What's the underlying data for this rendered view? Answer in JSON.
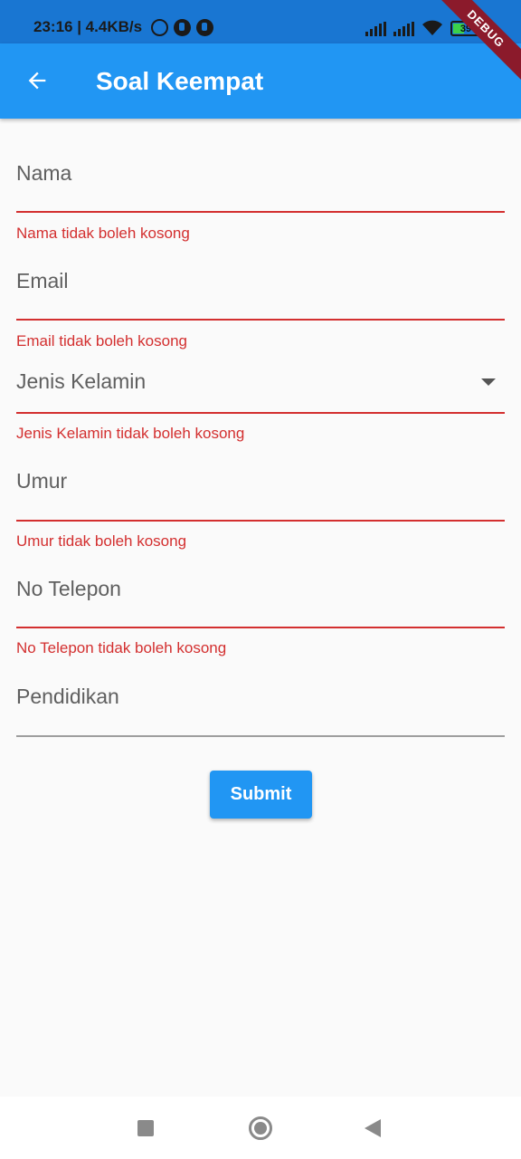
{
  "status_bar": {
    "time_speed": "23:16 | 4.4KB/s",
    "battery": "39",
    "icons": [
      "alarm-icon",
      "app-notification-icon",
      "app-notification-icon",
      "signal-icon",
      "signal-icon",
      "wifi-icon",
      "battery-icon"
    ]
  },
  "debug_banner": "DEBUG",
  "app_bar": {
    "title": "Soal Keempat",
    "back_icon": "arrow-back-icon"
  },
  "form": {
    "fields": [
      {
        "label": "Nama",
        "error": "Nama tidak boleh kosong"
      },
      {
        "label": "Email",
        "error": "Email tidak boleh kosong"
      },
      {
        "label": "Jenis Kelamin",
        "error": "Jenis Kelamin tidak boleh kosong",
        "type": "dropdown"
      },
      {
        "label": "Umur",
        "error": "Umur tidak boleh kosong"
      },
      {
        "label": "No Telepon",
        "error": "No Telepon tidak boleh kosong"
      },
      {
        "label": "Pendidikan",
        "error": ""
      }
    ],
    "submit_label": "Submit"
  },
  "colors": {
    "app_bar": "#2196f3",
    "status_bar": "#1976d2",
    "error": "#d32f2f",
    "background": "#fafafa"
  },
  "nav_bar": {
    "icons": [
      "recent-apps-icon",
      "home-icon",
      "back-icon"
    ]
  }
}
